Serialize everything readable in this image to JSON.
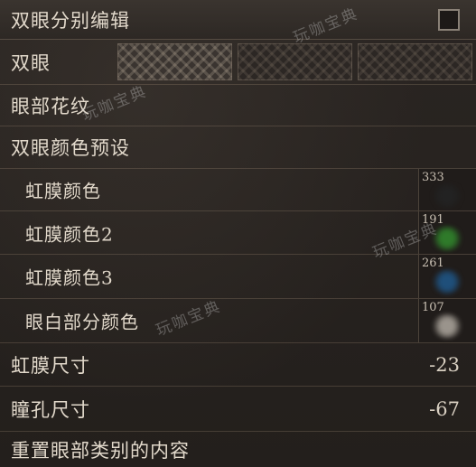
{
  "header": {
    "title": "双眼分别编辑",
    "checked": false
  },
  "tab_label": "双眼",
  "rows": {
    "eye_pattern": "眼部花纹",
    "eye_color_preset": "双眼颜色预设",
    "iris_size": {
      "label": "虹膜尺寸",
      "value": "-23"
    },
    "pupil_size": {
      "label": "瞳孔尺寸",
      "value": "-67"
    },
    "reset": "重置眼部类别的内容"
  },
  "colors": [
    {
      "label": "虹膜颜色",
      "value": "333",
      "color": "#222222"
    },
    {
      "label": "虹膜颜色2",
      "value": "191",
      "color": "#2f7a2a"
    },
    {
      "label": "虹膜颜色3",
      "value": "261",
      "color": "#1f4f7a"
    },
    {
      "label": "眼白部分颜色",
      "value": "107",
      "color": "#9a948c"
    }
  ],
  "watermark": "玩咖宝典"
}
